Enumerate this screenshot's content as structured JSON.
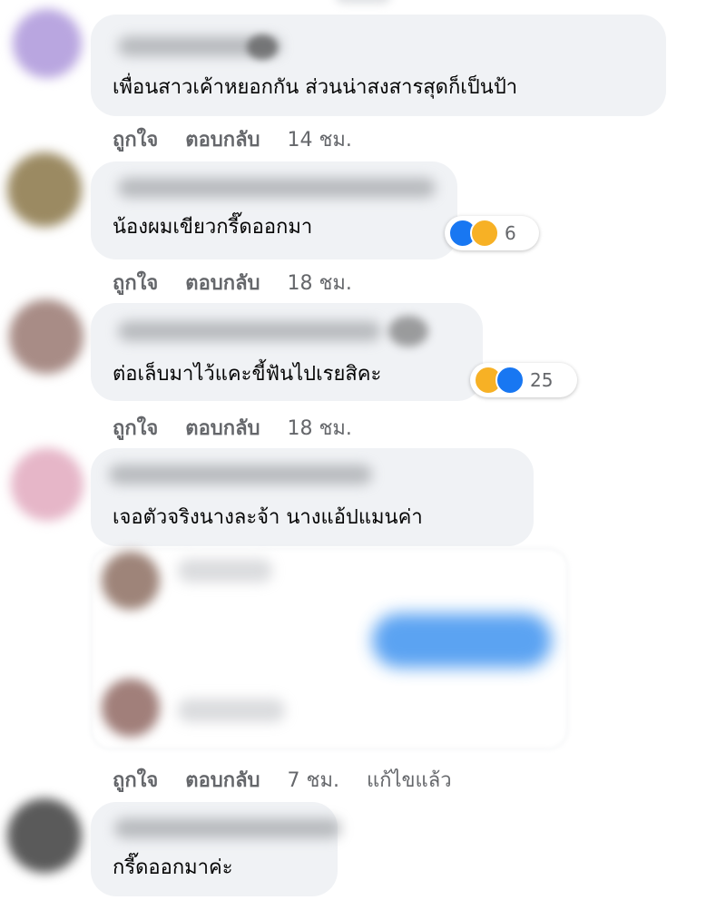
{
  "comments": [
    {
      "text": "เพื่อนสาวเค้าหยอกกัน ส่วนน่าสงสารสุดก็เป็นป้า",
      "like": "ถูกใจ",
      "reply": "ตอบกลับ",
      "time": "14 ชม."
    },
    {
      "text": "น้องผมเขียวกรี๊ดออกมา",
      "like": "ถูกใจ",
      "reply": "ตอบกลับ",
      "time": "18 ชม.",
      "reactions": {
        "count": "6",
        "icons": [
          "like-icon",
          "haha-icon"
        ]
      }
    },
    {
      "text": "ต่อเล็บมาไว้แคะขี้ฟันไปเรยสิคะ",
      "like": "ถูกใจ",
      "reply": "ตอบกลับ",
      "time": "18 ชม.",
      "reactions": {
        "count": "25",
        "icons": [
          "haha-icon",
          "like-icon"
        ]
      }
    },
    {
      "text": "เจอตัวจริงนางละจ้า นางแอ้ปแมนค่า",
      "like": "ถูกใจ",
      "reply": "ตอบกลับ",
      "time": "7 ชม.",
      "edited": "แก้ไขแล้ว"
    },
    {
      "text": "กรี๊ดออกมาค่ะ"
    }
  ],
  "colors": {
    "bubble": "#f0f2f5",
    "meta": "#65676b",
    "like_blue": "#1877f2",
    "haha_yellow": "#f7b125"
  }
}
